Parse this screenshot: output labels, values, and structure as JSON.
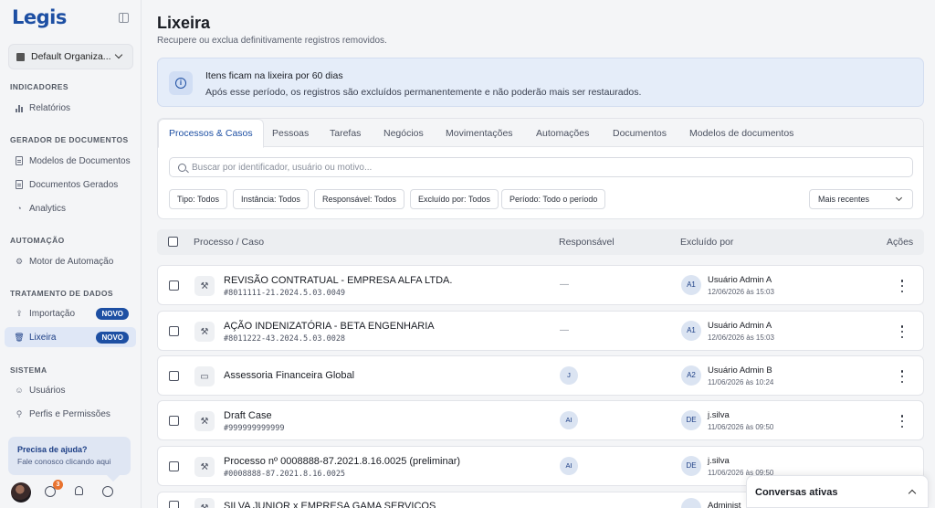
{
  "app": {
    "logo": "Legis"
  },
  "sidebar": {
    "org": "Default Organiza...",
    "sections": [
      {
        "title": "INDICADORES"
      },
      {
        "title": "GERADOR DE DOCUMENTOS"
      },
      {
        "title": "AUTOMAÇÃO"
      },
      {
        "title": "TRATAMENTO DE DADOS"
      },
      {
        "title": "SISTEMA"
      }
    ],
    "items": [
      {
        "label": "Relatórios",
        "icon": "bar-chart-icon"
      },
      {
        "label": "Modelos de Documentos",
        "icon": "document-icon"
      },
      {
        "label": "Documentos Gerados",
        "icon": "document-icon"
      },
      {
        "label": "Analytics",
        "icon": "analytics-icon"
      },
      {
        "label": "Motor de Automação",
        "icon": "gear-icon"
      },
      {
        "label": "Importação",
        "icon": "upload-icon",
        "badge": "NOVO"
      },
      {
        "label": "Lixeira",
        "icon": "trash-icon",
        "badge": "NOVO",
        "active": true
      },
      {
        "label": "Usuários",
        "icon": "users-icon"
      },
      {
        "label": "Perfis e Permissões",
        "icon": "sliders-icon"
      }
    ],
    "help": {
      "title": "Precisa de ajuda?",
      "subtitle": "Fale conosco clicando aqui"
    },
    "notifications_count": "3"
  },
  "main": {
    "title": "Lixeira",
    "subtitle": "Recupere ou exclua definitivamente registros removidos.",
    "info": {
      "title": "Itens ficam na lixeira por 60 dias",
      "text": "Após esse período, os registros são excluídos permanentemente e não poderão mais ser restaurados."
    },
    "tabs": [
      {
        "label": "Processos & Casos",
        "active": true
      },
      {
        "label": "Pessoas"
      },
      {
        "label": "Tarefas"
      },
      {
        "label": "Negócios"
      },
      {
        "label": "Movimentações"
      },
      {
        "label": "Automações"
      },
      {
        "label": "Documentos"
      },
      {
        "label": "Modelos de documentos"
      }
    ],
    "search_placeholder": "Buscar por identificador, usuário ou motivo...",
    "filters": [
      "Tipo: Todos",
      "Instância: Todos",
      "Responsável: Todos",
      "Excluído por: Todos",
      "Período: Todo o período"
    ],
    "sort": "Mais recentes",
    "columns": {
      "process": "Processo / Caso",
      "responsible": "Responsável",
      "deleted_by": "Excluído por",
      "actions": "Ações"
    },
    "rows": [
      {
        "title": "REVISÃO CONTRATUAL - EMPRESA ALFA LTDA.",
        "id": "#8011111-21.2024.5.03.0049",
        "type_icon": "gavel-icon",
        "responsible": "—",
        "user_initials": "A1",
        "user": "Usuário Admin A",
        "date": "12/06/2026 às 15:03"
      },
      {
        "title": "AÇÃO INDENIZATÓRIA - BETA ENGENHARIA",
        "id": "#8011222-43.2024.5.03.0028",
        "type_icon": "gavel-icon",
        "responsible": "—",
        "user_initials": "A1",
        "user": "Usuário Admin A",
        "date": "12/06/2026 às 15:03"
      },
      {
        "title": "Assessoria Financeira Global",
        "id": "",
        "type_icon": "folder-icon",
        "responsible": "J",
        "user_initials": "A2",
        "user": "Usuário Admin B",
        "date": "11/06/2026 às 10:24"
      },
      {
        "title": "Draft Case",
        "id": "#999999999999",
        "type_icon": "gavel-icon",
        "responsible": "AI",
        "user_initials": "DE",
        "user": "j.silva",
        "date": "11/06/2026 às 09:50"
      },
      {
        "title": "Processo nº 0008888-87.2021.8.16.0025 (preliminar)",
        "id": "#0008888-87.2021.8.16.0025",
        "type_icon": "gavel-icon",
        "responsible": "AI",
        "user_initials": "DE",
        "user": "j.silva",
        "date": "11/06/2026 às 09:50"
      },
      {
        "title": "SILVA JUNIOR x EMPRESA GAMA SERVICOS",
        "id": "",
        "type_icon": "gavel-icon",
        "responsible": "",
        "user_initials": "",
        "user": "Administ",
        "date": ""
      }
    ],
    "chat": "Conversas ativas"
  }
}
